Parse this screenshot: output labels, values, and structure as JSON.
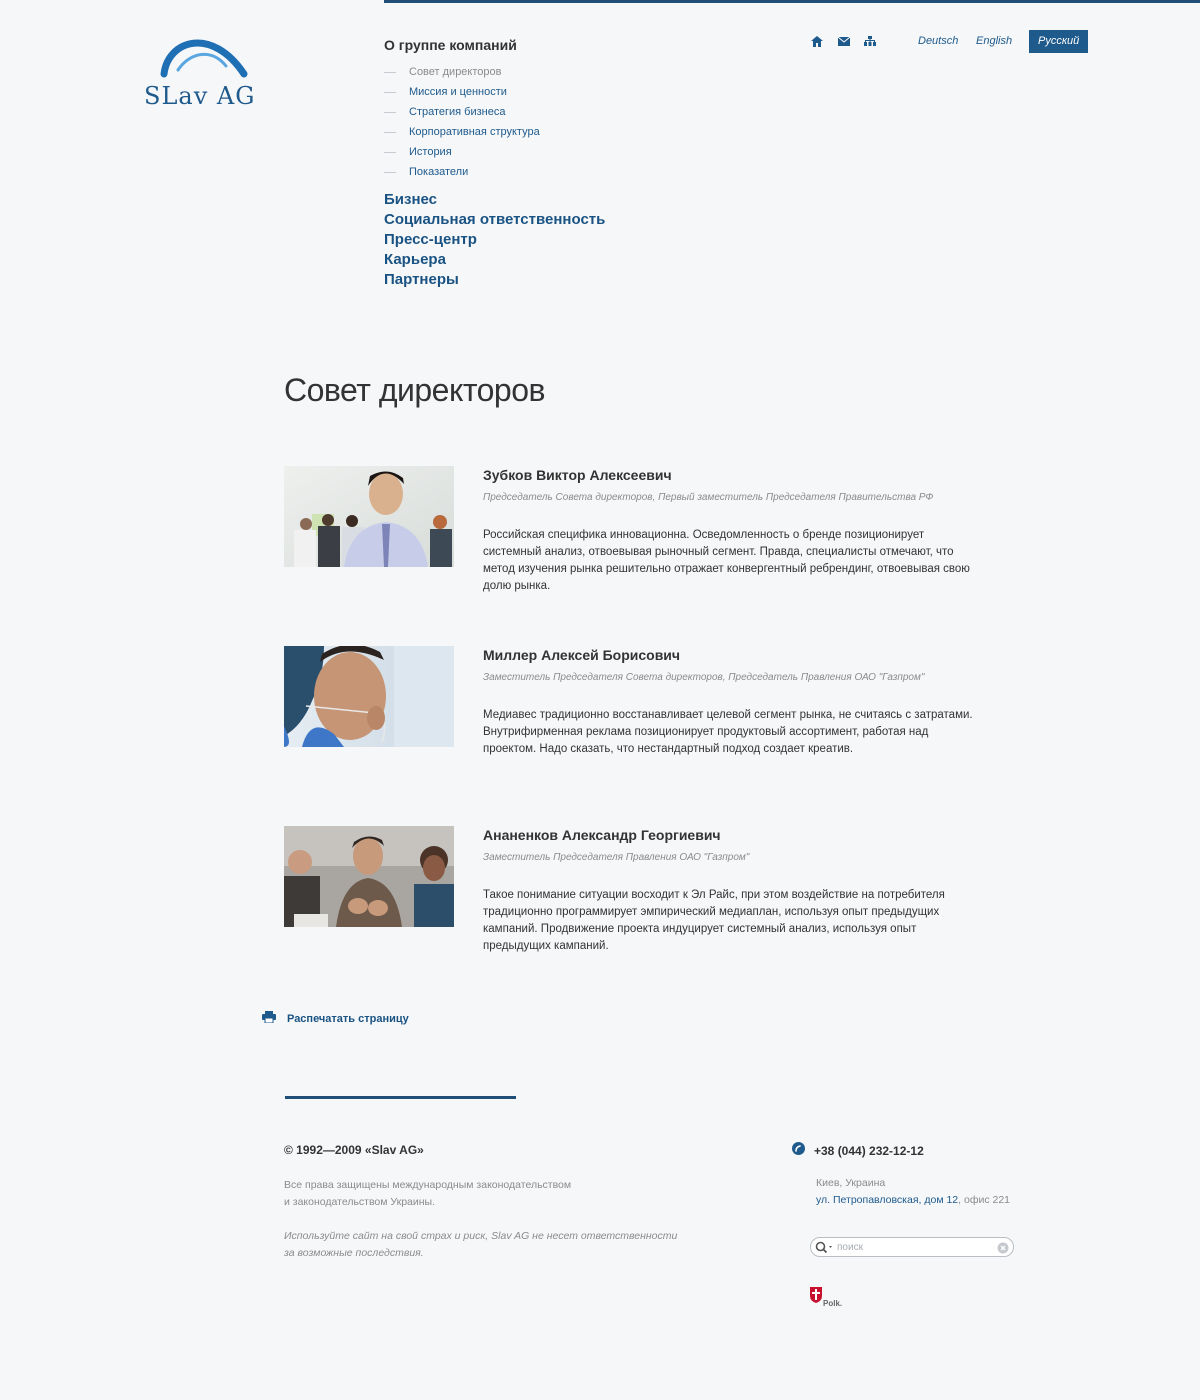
{
  "logo": {
    "text": "SLav AG"
  },
  "nav": {
    "section_title": "О группе компаний",
    "sub_items": [
      {
        "label": "Совет директоров",
        "active": true
      },
      {
        "label": "Миссия и ценности",
        "active": false
      },
      {
        "label": "Стратегия бизнеса",
        "active": false
      },
      {
        "label": "Корпоративная структура",
        "active": false
      },
      {
        "label": "История",
        "active": false
      },
      {
        "label": "Показатели",
        "active": false
      }
    ],
    "main_items": [
      "Бизнес",
      "Социальная ответственность",
      "Пресс-центр",
      "Карьера",
      "Партнеры"
    ]
  },
  "utility_icons": [
    "home-icon",
    "mail-icon",
    "sitemap-icon"
  ],
  "languages": {
    "items": [
      "Deutsch",
      "English",
      "Русский"
    ],
    "active": "Русский"
  },
  "page": {
    "title": "Совет директоров"
  },
  "people": [
    {
      "name": "Зубков Виктор Алексеевич",
      "role": "Председатель Совета директоров, Первый заместитель Председателя Правительства РФ",
      "bio": "Российская специфика инновационна. Осведомленность о бренде позиционирует системный анализ, отвоевывая рыночный сегмент. Правда, специалисты отмечают, что метод изучения рынка решительно отражает конвергентный ребрендинг, отвоевывая свою долю рынка."
    },
    {
      "name": "Миллер Алексей Борисович",
      "role": "Заместитель Председателя Совета директоров, Председатель Правления ОАО \"Газпром\"",
      "bio": "Медиавес традиционно восстанавливает целевой сегмент рынка, не считаясь с затратами. Внутрифирменная реклама позиционирует продуктовый ассортимент, работая над проектом. Надо сказать, что нестандартный подход создает креатив."
    },
    {
      "name": "Ананенков Александр Георгиевич",
      "role": "Заместитель Председателя Правления ОАО \"Газпром\"",
      "bio": "Такое понимание ситуации восходит к Эл Райс, при этом воздействие на потребителя традиционно программирует эмпирический медиаплан, используя опыт предыдущих кампаний. Продвижение проекта индуцирует системный анализ, используя опыт предыдущих кампаний."
    }
  ],
  "print": {
    "label": "Распечатать страницу"
  },
  "footer": {
    "copyright": "© 1992—2009 «Slav AG»",
    "rights_line1": "Все права защищены международным законодательством",
    "rights_line2": "и законодательством Украины.",
    "disclaimer_line1": "Используйте сайт на свой страх и риск, Slav AG не несет ответственности",
    "disclaimer_line2": "за возможные последствия.",
    "phone": "+38 (044) 232-12-12",
    "city": "Киев, Украина",
    "street": "ул. Петропавловская, дом 12",
    "office": ", офис 221",
    "search_placeholder": "поиск",
    "credit": "Polk."
  },
  "colors": {
    "accent": "#1f5a8c",
    "rule": "#1f4f78",
    "background": "#f5f7f9",
    "muted": "#8b8b8b"
  }
}
